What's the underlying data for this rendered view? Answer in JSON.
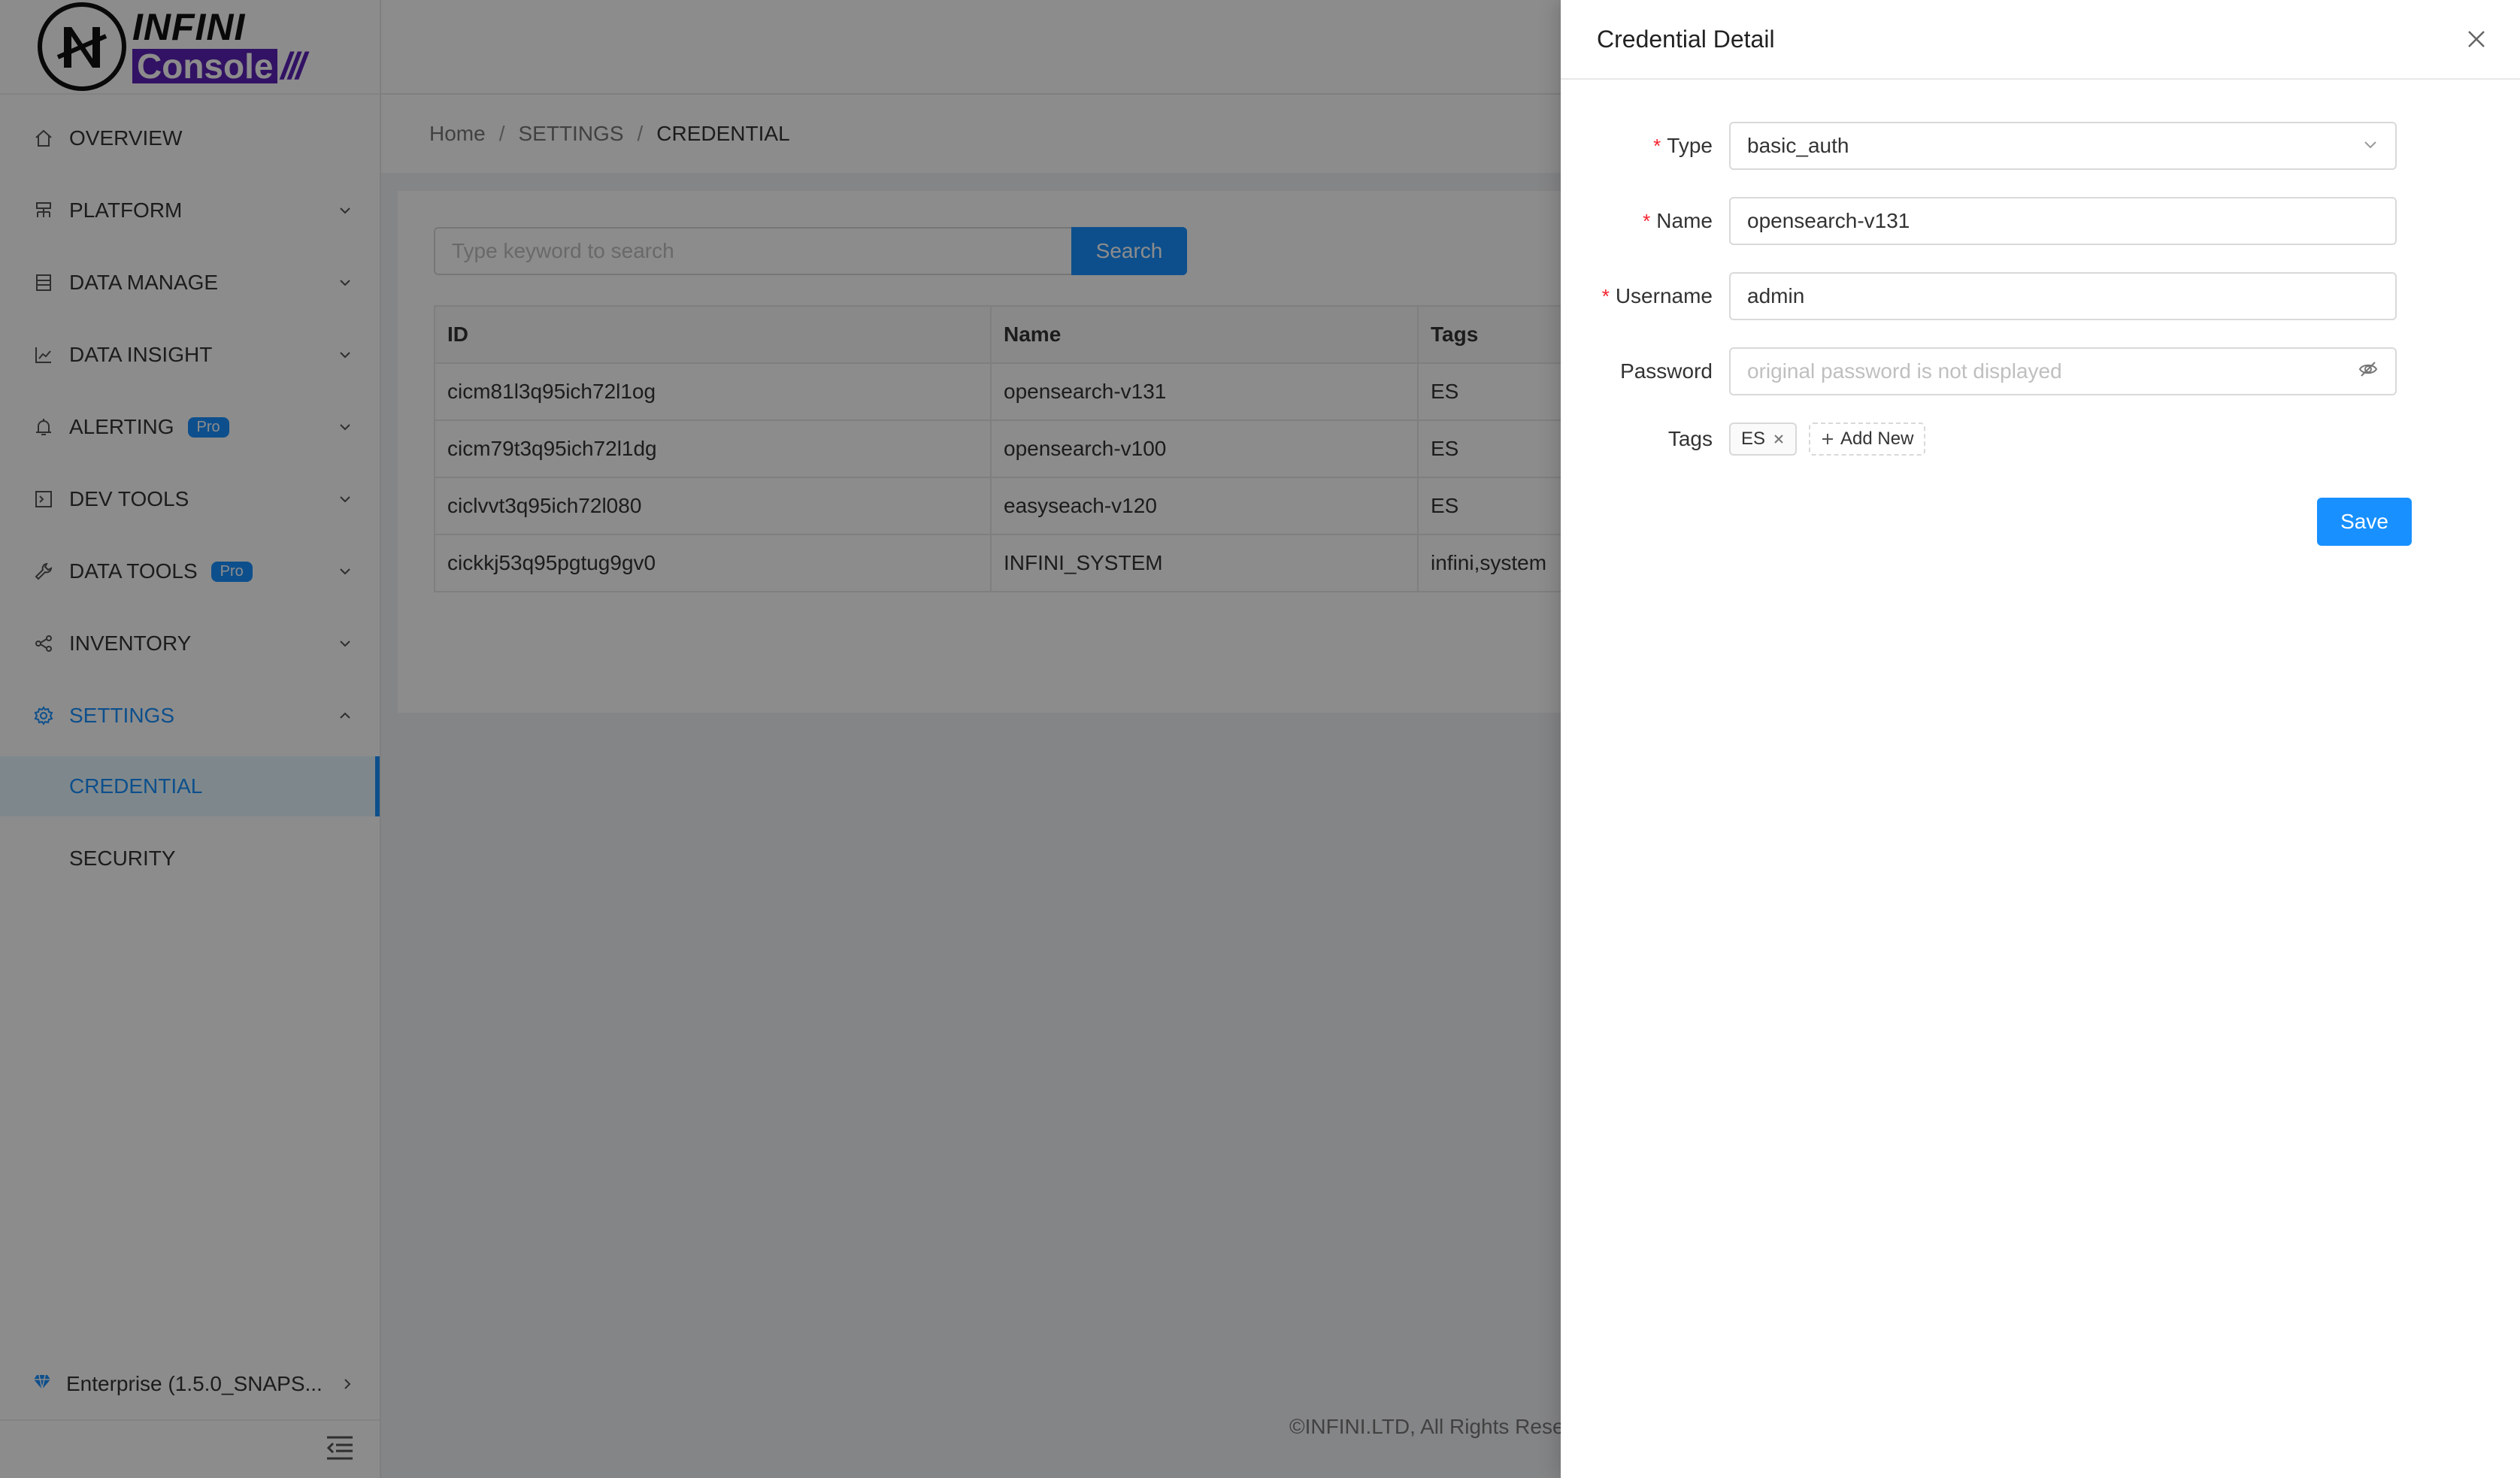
{
  "app": {
    "logo_word_top": "INFINI",
    "logo_word_bottom": "Console",
    "brand_color": "#5b21b6"
  },
  "sidebar": {
    "items": [
      {
        "label": "OVERVIEW",
        "icon": "home-icon"
      },
      {
        "label": "PLATFORM",
        "icon": "platform-icon"
      },
      {
        "label": "DATA MANAGE",
        "icon": "database-icon"
      },
      {
        "label": "DATA INSIGHT",
        "icon": "chart-icon"
      },
      {
        "label": "ALERTING",
        "icon": "bell-icon",
        "badge": "Pro"
      },
      {
        "label": "DEV TOOLS",
        "icon": "terminal-icon"
      },
      {
        "label": "DATA TOOLS",
        "icon": "wrench-icon",
        "badge": "Pro"
      },
      {
        "label": "INVENTORY",
        "icon": "share-icon"
      },
      {
        "label": "SETTINGS",
        "icon": "gear-icon",
        "expanded": true
      }
    ],
    "settings_children": [
      {
        "label": "CREDENTIAL",
        "selected": true
      },
      {
        "label": "SECURITY",
        "selected": false
      }
    ],
    "version": "Enterprise (1.5.0_SNAPS...",
    "accent_color": "#1890ff"
  },
  "breadcrumb": [
    "Home",
    "SETTINGS",
    "CREDENTIAL"
  ],
  "search": {
    "placeholder": "Type keyword to search",
    "button_label": "Search"
  },
  "table": {
    "columns": [
      "ID",
      "Name",
      "Tags"
    ],
    "rows": [
      [
        "cicm81l3q95ich72l1og",
        "opensearch-v131",
        "ES"
      ],
      [
        "cicm79t3q95ich72l1dg",
        "opensearch-v100",
        "ES"
      ],
      [
        "ciclvvt3q95ich72l080",
        "easyseach-v120",
        "ES"
      ],
      [
        "cickkj53q95pgtug9gv0",
        "INFINI_SYSTEM",
        "infini,system"
      ]
    ]
  },
  "footer": {
    "copyright": "©INFINI.LTD, All Rights Rese"
  },
  "drawer": {
    "title": "Credential Detail",
    "fields": {
      "type": {
        "label": "Type",
        "value": "basic_auth",
        "required": true
      },
      "name": {
        "label": "Name",
        "value": "opensearch-v131",
        "required": true
      },
      "username": {
        "label": "Username",
        "value": "admin",
        "required": true
      },
      "password": {
        "label": "Password",
        "placeholder": "original password is not displayed",
        "required": false
      },
      "tags": {
        "label": "Tags",
        "values": [
          "ES"
        ],
        "add_label": "Add New"
      }
    },
    "save_label": "Save"
  }
}
